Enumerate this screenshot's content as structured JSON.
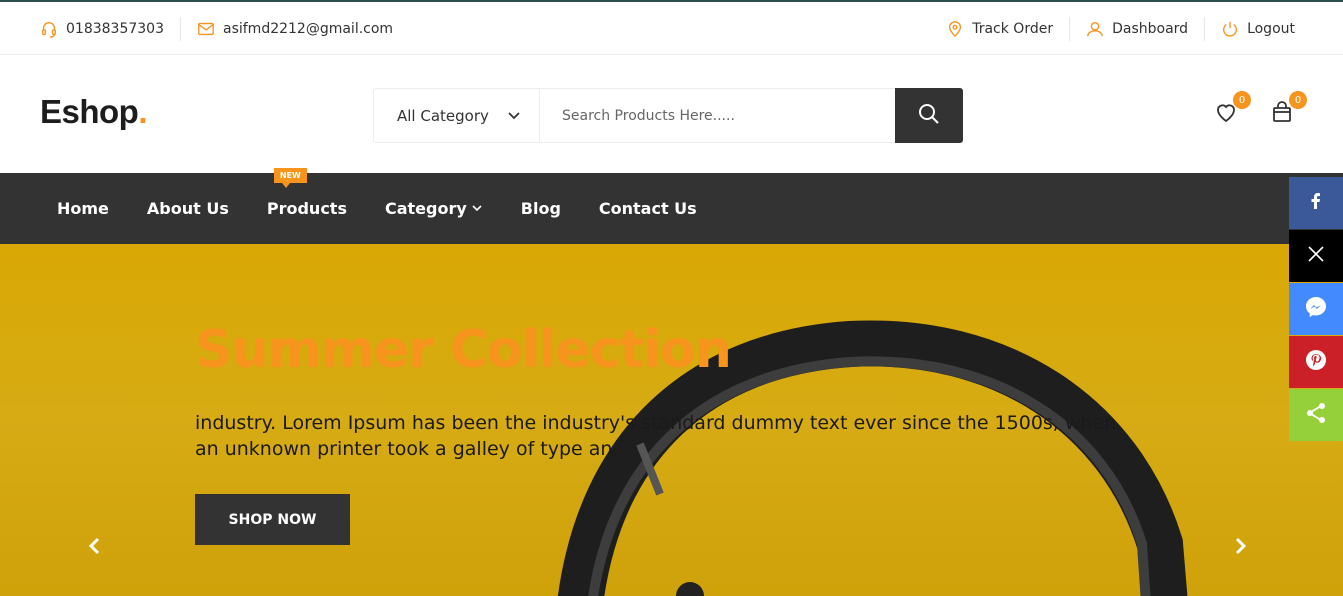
{
  "topbar": {
    "phone": "01838357303",
    "email": "asifmd2212@gmail.com",
    "track_order": "Track Order",
    "dashboard": "Dashboard",
    "logout": "Logout"
  },
  "header": {
    "logo": "Eshop",
    "logo_dot": ".",
    "category_select": "All Category",
    "search_placeholder": "Search Products Here.....",
    "wishlist_count": "0",
    "cart_count": "0"
  },
  "nav": {
    "items": [
      "Home",
      "About Us",
      "Products",
      "Category",
      "Blog",
      "Contact Us"
    ],
    "new_badge": "NEW"
  },
  "hero": {
    "title": "Summer Collection",
    "text": "industry. Lorem Ipsum has been the industry's standard dummy text ever since the 1500s, when an unknown printer took a galley of type an",
    "button": "SHOP NOW"
  },
  "social": [
    "facebook-icon",
    "x-icon",
    "messenger-icon",
    "pinterest-icon",
    "share-icon"
  ],
  "colors": {
    "accent": "#f7941d",
    "dark": "#333333",
    "hero_bg": "#d6a80e",
    "facebook": "#3b5998",
    "x": "#000000",
    "messenger": "#448aff",
    "pinterest": "#cb2027",
    "share": "#95d03a"
  }
}
